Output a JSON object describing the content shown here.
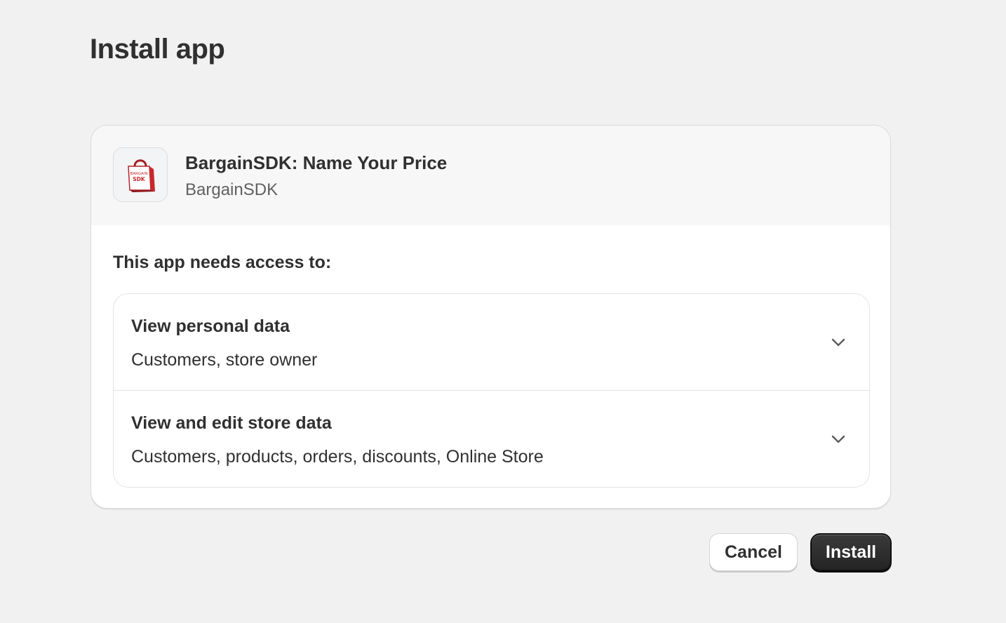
{
  "page": {
    "title": "Install app"
  },
  "app": {
    "name": "BargainSDK: Name Your Price",
    "developer": "BargainSDK",
    "icon": "shopping-bag-icon",
    "icon_text": "SDK"
  },
  "permissions": {
    "heading": "This app needs access to:",
    "items": [
      {
        "title": "View personal data",
        "description": "Customers, store owner",
        "icon": "chevron-down-icon"
      },
      {
        "title": "View and edit store data",
        "description": "Customers, products, orders, discounts, Online Store",
        "icon": "chevron-down-icon"
      }
    ]
  },
  "actions": {
    "cancel_label": "Cancel",
    "install_label": "Install"
  },
  "colors": {
    "background": "#f1f1f1",
    "card": "#ffffff",
    "card_header": "#f7f7f7",
    "primary_button": "#2b2b2b",
    "text": "#303030",
    "muted_text": "#616161",
    "brand_red": "#c8282d"
  }
}
